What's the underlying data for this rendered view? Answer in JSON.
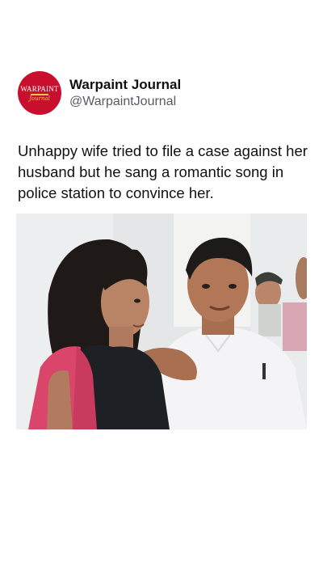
{
  "post": {
    "author": {
      "display_name": "Warpaint Journal",
      "handle": "@WarpaintJournal",
      "avatar_logo_text": "WARPAINT",
      "avatar_logo_subtext": "Journal",
      "avatar_color": "#c8102e"
    },
    "text": "Unhappy wife tried to file a case against her husband but he sang a romantic song in police station to convince her.",
    "media": {
      "type": "video-still",
      "description_icon": "video-frame"
    }
  },
  "colors": {
    "background": "#ffffff",
    "text": "#111111",
    "handle": "#555b62",
    "brand_red": "#c8102e"
  }
}
